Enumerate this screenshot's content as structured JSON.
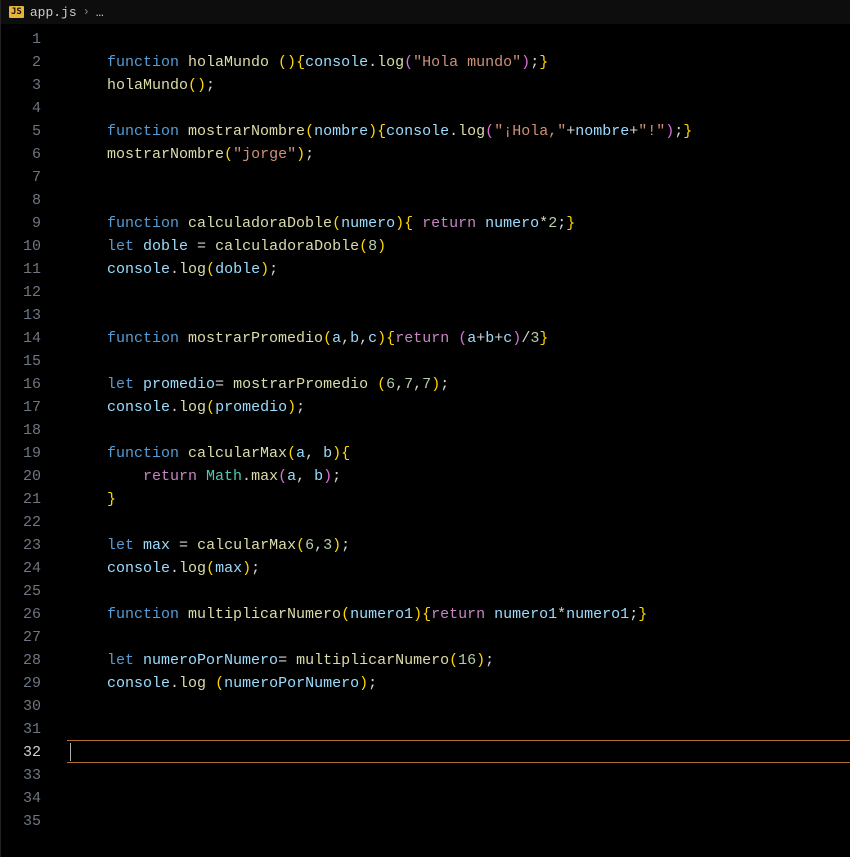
{
  "breadcrumb": {
    "js_badge": "JS",
    "file": "app.js",
    "chevron": "›",
    "rest": "…"
  },
  "active_line": 32,
  "lines": [
    {
      "n": 1,
      "tokens": []
    },
    {
      "n": 2,
      "indent": 1,
      "tokens": [
        {
          "t": "function ",
          "c": "kw"
        },
        {
          "t": "holaMundo ",
          "c": "fn"
        },
        {
          "t": "()",
          "c": "p1"
        },
        {
          "t": "{",
          "c": "p1"
        },
        {
          "t": "console",
          "c": "id"
        },
        {
          "t": ".",
          "c": "w"
        },
        {
          "t": "log",
          "c": "fn"
        },
        {
          "t": "(",
          "c": "p2"
        },
        {
          "t": "\"Hola mundo\"",
          "c": "str"
        },
        {
          "t": ")",
          "c": "p2"
        },
        {
          "t": ";",
          "c": "w"
        },
        {
          "t": "}",
          "c": "p1"
        }
      ]
    },
    {
      "n": 3,
      "indent": 1,
      "tokens": [
        {
          "t": "holaMundo",
          "c": "fn"
        },
        {
          "t": "()",
          "c": "p1"
        },
        {
          "t": ";",
          "c": "w"
        }
      ]
    },
    {
      "n": 4,
      "tokens": []
    },
    {
      "n": 5,
      "indent": 1,
      "tokens": [
        {
          "t": "function ",
          "c": "kw"
        },
        {
          "t": "mostrarNombre",
          "c": "fn"
        },
        {
          "t": "(",
          "c": "p1"
        },
        {
          "t": "nombre",
          "c": "id"
        },
        {
          "t": ")",
          "c": "p1"
        },
        {
          "t": "{",
          "c": "p1"
        },
        {
          "t": "console",
          "c": "id"
        },
        {
          "t": ".",
          "c": "w"
        },
        {
          "t": "log",
          "c": "fn"
        },
        {
          "t": "(",
          "c": "p2"
        },
        {
          "t": "\"¡Hola,\"",
          "c": "str"
        },
        {
          "t": "+",
          "c": "w"
        },
        {
          "t": "nombre",
          "c": "id"
        },
        {
          "t": "+",
          "c": "w"
        },
        {
          "t": "\"!\"",
          "c": "str"
        },
        {
          "t": ")",
          "c": "p2"
        },
        {
          "t": ";",
          "c": "w"
        },
        {
          "t": "}",
          "c": "p1"
        }
      ]
    },
    {
      "n": 6,
      "indent": 1,
      "tokens": [
        {
          "t": "mostrarNombre",
          "c": "fn"
        },
        {
          "t": "(",
          "c": "p1"
        },
        {
          "t": "\"jorge\"",
          "c": "str"
        },
        {
          "t": ")",
          "c": "p1"
        },
        {
          "t": ";",
          "c": "w"
        }
      ]
    },
    {
      "n": 7,
      "tokens": []
    },
    {
      "n": 8,
      "tokens": []
    },
    {
      "n": 9,
      "indent": 1,
      "tokens": [
        {
          "t": "function ",
          "c": "kw"
        },
        {
          "t": "calculadoraDoble",
          "c": "fn"
        },
        {
          "t": "(",
          "c": "p1"
        },
        {
          "t": "numero",
          "c": "id"
        },
        {
          "t": ")",
          "c": "p1"
        },
        {
          "t": "{",
          "c": "p1"
        },
        {
          "t": " ",
          "c": "w"
        },
        {
          "t": "return ",
          "c": "ret"
        },
        {
          "t": "numero",
          "c": "id"
        },
        {
          "t": "*",
          "c": "w"
        },
        {
          "t": "2",
          "c": "num"
        },
        {
          "t": ";",
          "c": "w"
        },
        {
          "t": "}",
          "c": "p1"
        }
      ]
    },
    {
      "n": 10,
      "indent": 1,
      "tokens": [
        {
          "t": "let ",
          "c": "kw"
        },
        {
          "t": "doble",
          "c": "id"
        },
        {
          "t": " = ",
          "c": "w"
        },
        {
          "t": "calculadoraDoble",
          "c": "fn"
        },
        {
          "t": "(",
          "c": "p1"
        },
        {
          "t": "8",
          "c": "num"
        },
        {
          "t": ")",
          "c": "p1"
        }
      ]
    },
    {
      "n": 11,
      "indent": 1,
      "tokens": [
        {
          "t": "console",
          "c": "id"
        },
        {
          "t": ".",
          "c": "w"
        },
        {
          "t": "log",
          "c": "fn"
        },
        {
          "t": "(",
          "c": "p1"
        },
        {
          "t": "doble",
          "c": "id"
        },
        {
          "t": ")",
          "c": "p1"
        },
        {
          "t": ";",
          "c": "w"
        }
      ]
    },
    {
      "n": 12,
      "tokens": []
    },
    {
      "n": 13,
      "tokens": []
    },
    {
      "n": 14,
      "indent": 1,
      "tokens": [
        {
          "t": "function ",
          "c": "kw"
        },
        {
          "t": "mostrarPromedio",
          "c": "fn"
        },
        {
          "t": "(",
          "c": "p1"
        },
        {
          "t": "a",
          "c": "id"
        },
        {
          "t": ",",
          "c": "w"
        },
        {
          "t": "b",
          "c": "id"
        },
        {
          "t": ",",
          "c": "w"
        },
        {
          "t": "c",
          "c": "id"
        },
        {
          "t": ")",
          "c": "p1"
        },
        {
          "t": "{",
          "c": "p1"
        },
        {
          "t": "return ",
          "c": "ret"
        },
        {
          "t": "(",
          "c": "p2"
        },
        {
          "t": "a",
          "c": "id"
        },
        {
          "t": "+",
          "c": "w"
        },
        {
          "t": "b",
          "c": "id"
        },
        {
          "t": "+",
          "c": "w"
        },
        {
          "t": "c",
          "c": "id"
        },
        {
          "t": ")",
          "c": "p2"
        },
        {
          "t": "/",
          "c": "w"
        },
        {
          "t": "3",
          "c": "num"
        },
        {
          "t": "}",
          "c": "p1"
        }
      ]
    },
    {
      "n": 15,
      "tokens": []
    },
    {
      "n": 16,
      "indent": 1,
      "tokens": [
        {
          "t": "let ",
          "c": "kw"
        },
        {
          "t": "promedio",
          "c": "id"
        },
        {
          "t": "= ",
          "c": "w"
        },
        {
          "t": "mostrarPromedio ",
          "c": "fn"
        },
        {
          "t": "(",
          "c": "p1"
        },
        {
          "t": "6",
          "c": "num"
        },
        {
          "t": ",",
          "c": "w"
        },
        {
          "t": "7",
          "c": "num"
        },
        {
          "t": ",",
          "c": "w"
        },
        {
          "t": "7",
          "c": "num"
        },
        {
          "t": ")",
          "c": "p1"
        },
        {
          "t": ";",
          "c": "w"
        }
      ]
    },
    {
      "n": 17,
      "indent": 1,
      "tokens": [
        {
          "t": "console",
          "c": "id"
        },
        {
          "t": ".",
          "c": "w"
        },
        {
          "t": "log",
          "c": "fn"
        },
        {
          "t": "(",
          "c": "p1"
        },
        {
          "t": "promedio",
          "c": "id"
        },
        {
          "t": ")",
          "c": "p1"
        },
        {
          "t": ";",
          "c": "w"
        }
      ]
    },
    {
      "n": 18,
      "tokens": []
    },
    {
      "n": 19,
      "indent": 1,
      "tokens": [
        {
          "t": "function ",
          "c": "kw"
        },
        {
          "t": "calcularMax",
          "c": "fn"
        },
        {
          "t": "(",
          "c": "p1"
        },
        {
          "t": "a",
          "c": "id"
        },
        {
          "t": ", ",
          "c": "w"
        },
        {
          "t": "b",
          "c": "id"
        },
        {
          "t": ")",
          "c": "p1"
        },
        {
          "t": "{",
          "c": "p1"
        }
      ]
    },
    {
      "n": 20,
      "indent": 2,
      "tokens": [
        {
          "t": "return ",
          "c": "ret"
        },
        {
          "t": "Math",
          "c": "cls"
        },
        {
          "t": ".",
          "c": "w"
        },
        {
          "t": "max",
          "c": "fn"
        },
        {
          "t": "(",
          "c": "p2"
        },
        {
          "t": "a",
          "c": "id"
        },
        {
          "t": ", ",
          "c": "w"
        },
        {
          "t": "b",
          "c": "id"
        },
        {
          "t": ")",
          "c": "p2"
        },
        {
          "t": ";",
          "c": "w"
        }
      ]
    },
    {
      "n": 21,
      "indent": 1,
      "tokens": [
        {
          "t": "}",
          "c": "p1"
        }
      ]
    },
    {
      "n": 22,
      "tokens": []
    },
    {
      "n": 23,
      "indent": 1,
      "tokens": [
        {
          "t": "let ",
          "c": "kw"
        },
        {
          "t": "max",
          "c": "id"
        },
        {
          "t": " = ",
          "c": "w"
        },
        {
          "t": "calcularMax",
          "c": "fn"
        },
        {
          "t": "(",
          "c": "p1"
        },
        {
          "t": "6",
          "c": "num"
        },
        {
          "t": ",",
          "c": "w"
        },
        {
          "t": "3",
          "c": "num"
        },
        {
          "t": ")",
          "c": "p1"
        },
        {
          "t": ";",
          "c": "w"
        }
      ]
    },
    {
      "n": 24,
      "indent": 1,
      "tokens": [
        {
          "t": "console",
          "c": "id"
        },
        {
          "t": ".",
          "c": "w"
        },
        {
          "t": "log",
          "c": "fn"
        },
        {
          "t": "(",
          "c": "p1"
        },
        {
          "t": "max",
          "c": "id"
        },
        {
          "t": ")",
          "c": "p1"
        },
        {
          "t": ";",
          "c": "w"
        }
      ]
    },
    {
      "n": 25,
      "tokens": []
    },
    {
      "n": 26,
      "indent": 1,
      "tokens": [
        {
          "t": "function ",
          "c": "kw"
        },
        {
          "t": "multiplicarNumero",
          "c": "fn"
        },
        {
          "t": "(",
          "c": "p1"
        },
        {
          "t": "numero1",
          "c": "id"
        },
        {
          "t": ")",
          "c": "p1"
        },
        {
          "t": "{",
          "c": "p1"
        },
        {
          "t": "return ",
          "c": "ret"
        },
        {
          "t": "numero1",
          "c": "id"
        },
        {
          "t": "*",
          "c": "w"
        },
        {
          "t": "numero1",
          "c": "id"
        },
        {
          "t": ";",
          "c": "w"
        },
        {
          "t": "}",
          "c": "p1"
        }
      ]
    },
    {
      "n": 27,
      "tokens": []
    },
    {
      "n": 28,
      "indent": 1,
      "tokens": [
        {
          "t": "let ",
          "c": "kw"
        },
        {
          "t": "numeroPorNumero",
          "c": "id"
        },
        {
          "t": "= ",
          "c": "w"
        },
        {
          "t": "multiplicarNumero",
          "c": "fn"
        },
        {
          "t": "(",
          "c": "p1"
        },
        {
          "t": "16",
          "c": "num"
        },
        {
          "t": ")",
          "c": "p1"
        },
        {
          "t": ";",
          "c": "w"
        }
      ]
    },
    {
      "n": 29,
      "indent": 1,
      "tokens": [
        {
          "t": "console",
          "c": "id"
        },
        {
          "t": ".",
          "c": "w"
        },
        {
          "t": "log ",
          "c": "fn"
        },
        {
          "t": "(",
          "c": "p1"
        },
        {
          "t": "numeroPorNumero",
          "c": "id"
        },
        {
          "t": ")",
          "c": "p1"
        },
        {
          "t": ";",
          "c": "w"
        }
      ]
    },
    {
      "n": 30,
      "tokens": []
    },
    {
      "n": 31,
      "tokens": []
    },
    {
      "n": 32,
      "tokens": []
    },
    {
      "n": 33,
      "tokens": []
    },
    {
      "n": 34,
      "tokens": []
    },
    {
      "n": 35,
      "tokens": []
    }
  ]
}
